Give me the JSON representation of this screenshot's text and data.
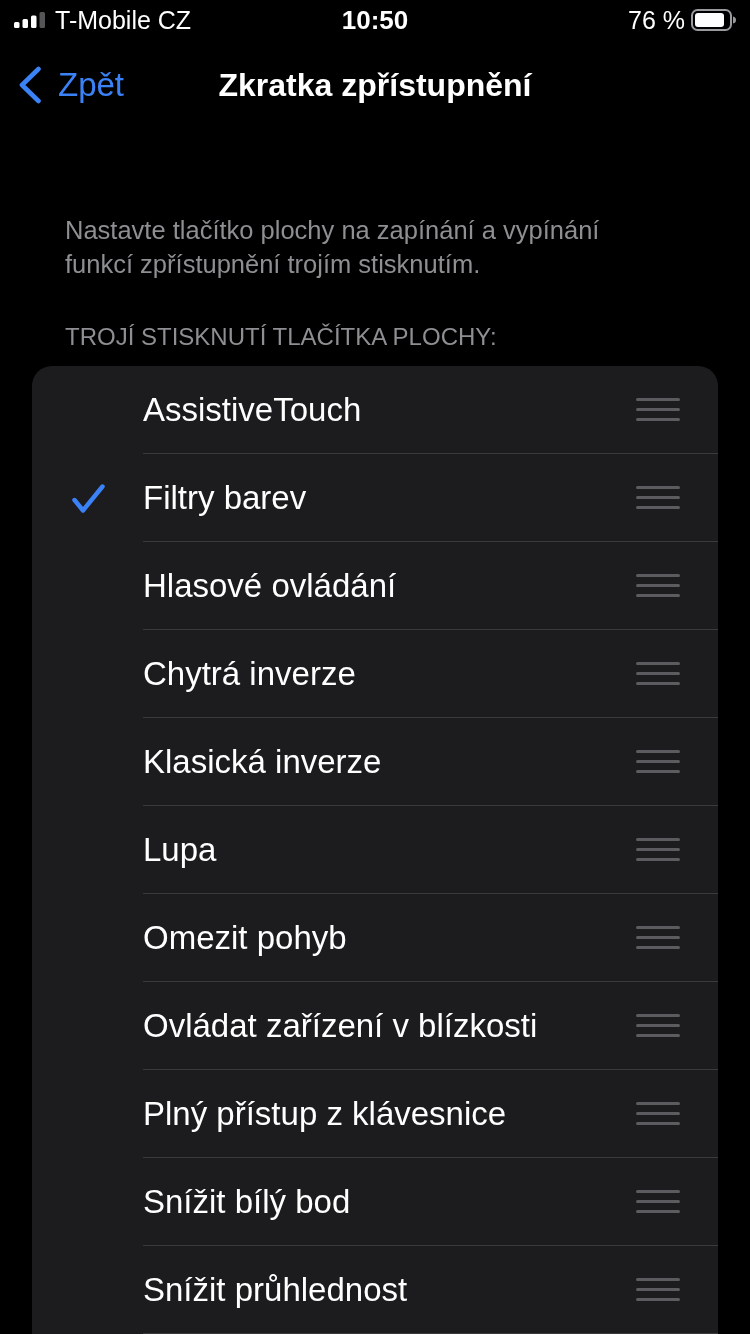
{
  "status_bar": {
    "carrier": "T-Mobile CZ",
    "time": "10:50",
    "battery": "76 %"
  },
  "nav_bar": {
    "back": "Zpět",
    "title": "Zkratka zpřístupnění"
  },
  "description": "Nastavte tlačítko plochy na zapínání a vypínání funkcí zpřístupnění trojím stisknutím.",
  "section_header": "TROJÍ STISKNUTÍ TLAČÍTKA PLOCHY:",
  "options": [
    {
      "label": "AssistiveTouch",
      "checked": false
    },
    {
      "label": "Filtry barev",
      "checked": true
    },
    {
      "label": "Hlasové ovládání",
      "checked": false
    },
    {
      "label": "Chytrá inverze",
      "checked": false
    },
    {
      "label": "Klasická inverze",
      "checked": false
    },
    {
      "label": "Lupa",
      "checked": false
    },
    {
      "label": "Omezit pohyb",
      "checked": false
    },
    {
      "label": "Ovládat zařízení v blízkosti",
      "checked": false
    },
    {
      "label": "Plný přístup z klávesnice",
      "checked": false
    },
    {
      "label": "Snížit bílý bod",
      "checked": false
    },
    {
      "label": "Snížit průhlednost",
      "checked": false
    }
  ]
}
